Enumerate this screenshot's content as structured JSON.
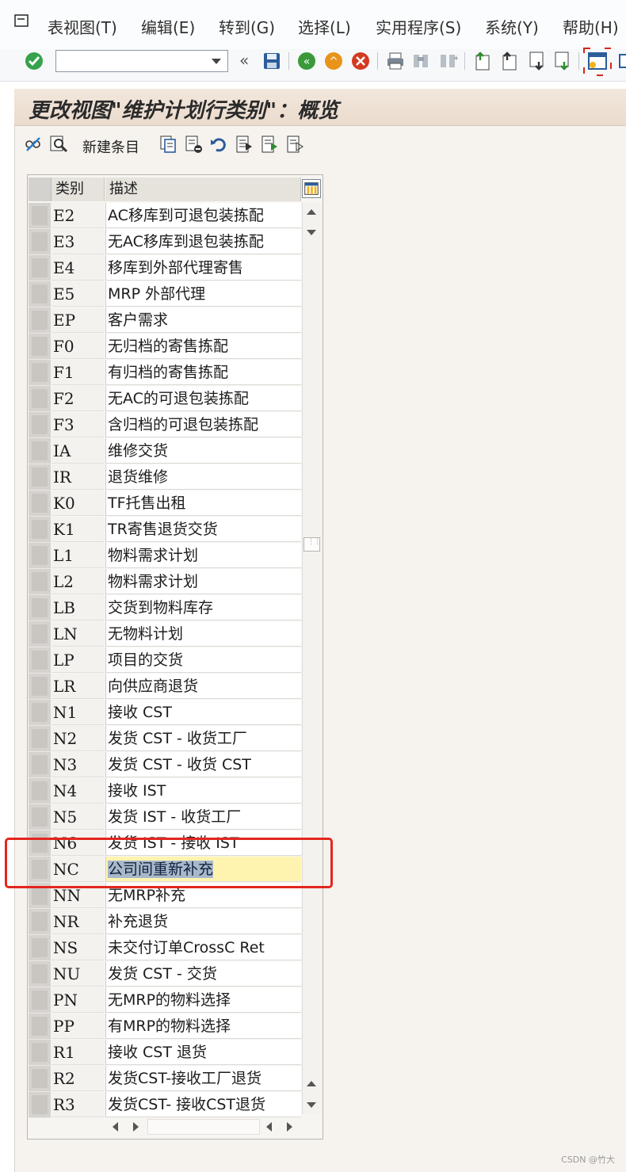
{
  "menubar": {
    "items": [
      "表视图(T)",
      "编辑(E)",
      "转到(G)",
      "选择(L)",
      "实用程序(S)",
      "系统(Y)",
      "帮助(H)"
    ]
  },
  "toolbar": {
    "command_field_value": "",
    "back_label": "«"
  },
  "page": {
    "title": "更改视图\"维护计划行类别\"：概览"
  },
  "app_toolbar": {
    "new_entries_label": "新建条目"
  },
  "table": {
    "headers": [
      "类别",
      "描述"
    ],
    "selected_index": 25,
    "rows": [
      {
        "code": "E2",
        "desc": "AC移库到可退包装拣配"
      },
      {
        "code": "E3",
        "desc": "无AC移库到退包装拣配"
      },
      {
        "code": "E4",
        "desc": "移库到外部代理寄售"
      },
      {
        "code": "E5",
        "desc": "MRP 外部代理"
      },
      {
        "code": "EP",
        "desc": "客户需求"
      },
      {
        "code": "F0",
        "desc": "无归档的寄售拣配"
      },
      {
        "code": "F1",
        "desc": "有归档的寄售拣配"
      },
      {
        "code": "F2",
        "desc": "无AC的可退包装拣配"
      },
      {
        "code": "F3",
        "desc": "含归档的可退包装拣配"
      },
      {
        "code": "IA",
        "desc": "维修交货"
      },
      {
        "code": "IR",
        "desc": "退货维修"
      },
      {
        "code": "K0",
        "desc": "TF托售出租"
      },
      {
        "code": "K1",
        "desc": "TR寄售退货交货"
      },
      {
        "code": "L1",
        "desc": "物料需求计划"
      },
      {
        "code": "L2",
        "desc": "物料需求计划"
      },
      {
        "code": "LB",
        "desc": "交货到物料库存"
      },
      {
        "code": "LN",
        "desc": "无物料计划"
      },
      {
        "code": "LP",
        "desc": "项目的交货"
      },
      {
        "code": "LR",
        "desc": "向供应商退货"
      },
      {
        "code": "N1",
        "desc": "接收 CST"
      },
      {
        "code": "N2",
        "desc": "发货 CST - 收货工厂"
      },
      {
        "code": "N3",
        "desc": "发货 CST - 收货 CST"
      },
      {
        "code": "N4",
        "desc": "接收 IST"
      },
      {
        "code": "N5",
        "desc": "发货 IST - 收货工厂"
      },
      {
        "code": "N6",
        "desc": "发货 IST - 接收 IST"
      },
      {
        "code": "NC",
        "desc": "公司间重新补充"
      },
      {
        "code": "NN",
        "desc": "无MRP补充"
      },
      {
        "code": "NR",
        "desc": "补充退货"
      },
      {
        "code": "NS",
        "desc": "未交付订单CrossC Ret"
      },
      {
        "code": "NU",
        "desc": "发货 CST - 交货"
      },
      {
        "code": "PN",
        "desc": "无MRP的物料选择"
      },
      {
        "code": "PP",
        "desc": "有MRP的物料选择"
      },
      {
        "code": "R1",
        "desc": "接收 CST 退货"
      },
      {
        "code": "R2",
        "desc": "发货CST-接收工厂退货"
      },
      {
        "code": "R3",
        "desc": "发货CST- 接收CST退货"
      }
    ]
  },
  "watermark": "CSDN @竹大",
  "colors": {
    "title_bar": "#eadbcd",
    "selected_row": "#fef4b0",
    "annotation_red": "#e3261e"
  }
}
